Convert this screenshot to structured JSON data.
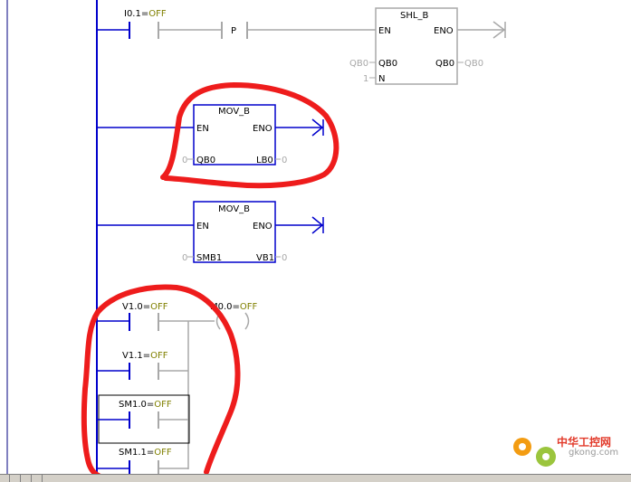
{
  "network_top": {
    "contact_label": "I0.1=",
    "contact_state": "OFF",
    "p_label": "P",
    "shl": {
      "title": "SHL_B",
      "en": "EN",
      "eno": "ENO",
      "in_pin": "QB0",
      "in_value": "QB0",
      "out_pin": "QB0",
      "out_value": "QB0",
      "n_pin": "N",
      "n_value": "1"
    }
  },
  "mov_b_1": {
    "title": "MOV_B",
    "en": "EN",
    "eno": "ENO",
    "in_pin": "QB0",
    "in_value": "0",
    "out_pin": "LB0",
    "out_value": "0"
  },
  "mov_b_2": {
    "title": "MOV_B",
    "en": "EN",
    "eno": "ENO",
    "in_pin": "SMB1",
    "in_value": "0",
    "out_pin": "VB1",
    "out_value": "0"
  },
  "network_bottom": {
    "c1_label": "V1.0=",
    "c1_state": "OFF",
    "coil_label": "M0.0=",
    "coil_state": "OFF",
    "c2_label": "V1.1=",
    "c2_state": "OFF",
    "c3_label": "SM1.0=",
    "c3_state": "OFF",
    "c4_label": "SM1.1=",
    "c4_state": "OFF"
  },
  "watermark": {
    "cn": "中华工控网",
    "url": "gkong.com"
  },
  "colors": {
    "rail": "#0000cc",
    "inactive": "#a8a8a8",
    "state_off": "#808000",
    "annotation": "#ee1c1c"
  }
}
